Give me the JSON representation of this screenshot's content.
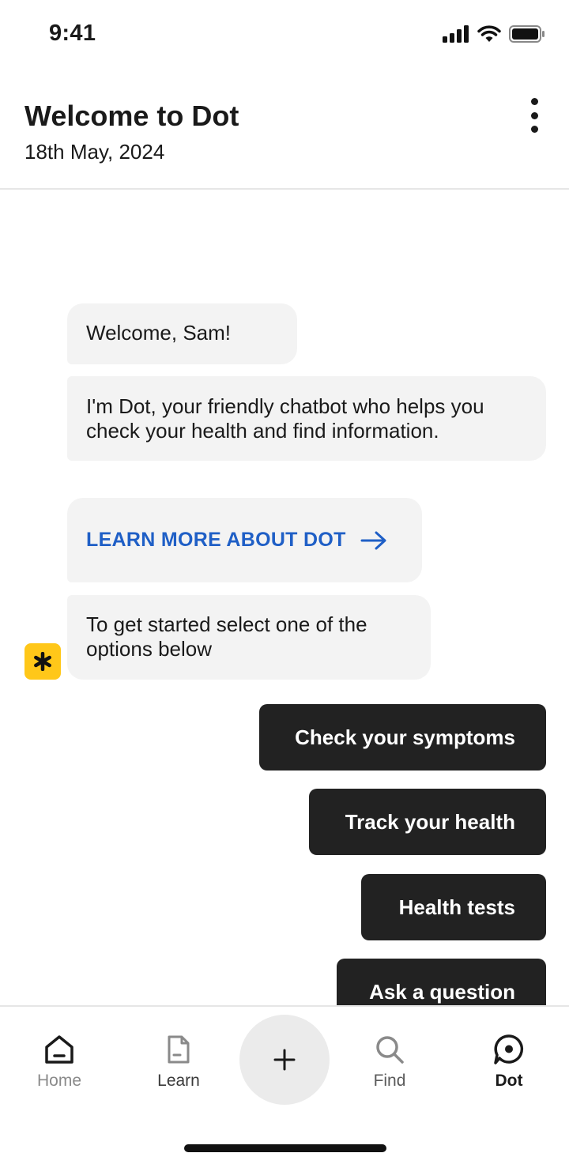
{
  "status_bar": {
    "time": "9:41",
    "icons": [
      "signal-icon",
      "wifi-icon",
      "battery-icon"
    ]
  },
  "header": {
    "title": "Welcome to Dot",
    "date": "18th May, 2024",
    "menu_icon": "more-vertical-icon"
  },
  "chat": {
    "messages": [
      {
        "text": "Welcome, Sam!"
      },
      {
        "text": "I'm Dot, your friendly chatbot who helps you check your health and find information."
      },
      {
        "text": "LEARN MORE ABOUT DOT",
        "icon": "arrow-right-icon"
      },
      {
        "text": "To get started select one of the options below"
      }
    ],
    "bot_avatar_icon": "asterisk-icon",
    "options": [
      {
        "label": "Check your symptoms"
      },
      {
        "label": "Track your health"
      },
      {
        "label": "Health tests"
      },
      {
        "label": "Ask a question"
      }
    ]
  },
  "tabbar": {
    "tabs": [
      {
        "label": "Home",
        "icon": "home-icon",
        "state": "inactive"
      },
      {
        "label": "Learn",
        "icon": "document-icon",
        "state": "inactive"
      },
      {
        "label": "Find",
        "icon": "search-icon",
        "state": "inactive"
      },
      {
        "label": "Dot",
        "icon": "chat-icon",
        "state": "active"
      }
    ],
    "fab_icon": "plus-icon"
  },
  "colors": {
    "link": "#1f5fc6",
    "button_bg": "#222222",
    "bubble_bg": "#f3f3f3",
    "avatar_bg": "#ffc719"
  }
}
